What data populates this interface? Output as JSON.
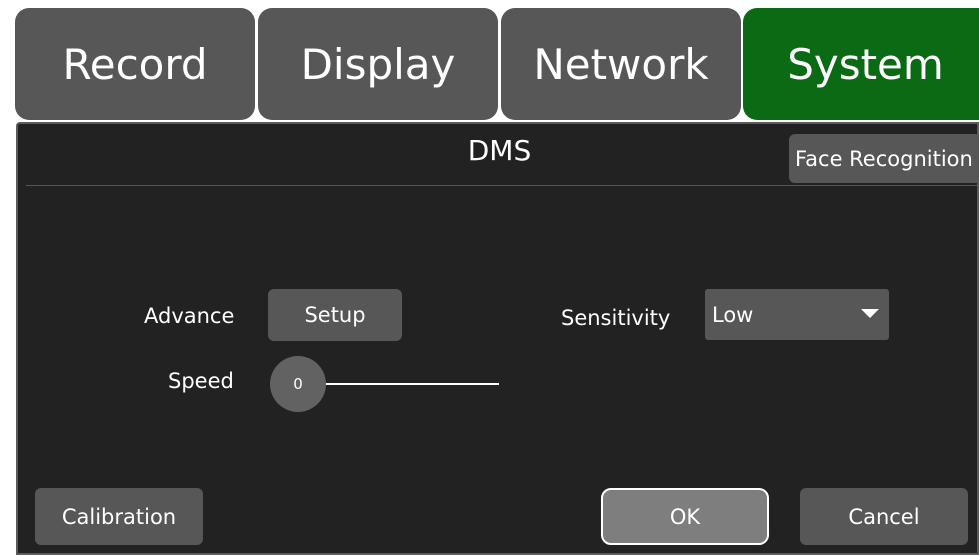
{
  "tabs": [
    {
      "label": "Record"
    },
    {
      "label": "Display"
    },
    {
      "label": "Network"
    },
    {
      "label": "System"
    }
  ],
  "panel": {
    "title": "DMS",
    "face_recognition_label": "Face Recognition",
    "advance_label": "Advance",
    "setup_label": "Setup",
    "sensitivity_label": "Sensitivity",
    "sensitivity_value": "Low",
    "speed_label": "Speed",
    "speed_value": "0"
  },
  "footer": {
    "calibration_label": "Calibration",
    "ok_label": "OK",
    "cancel_label": "Cancel"
  },
  "colors": {
    "tab": "#575757",
    "tab_active": "#0b6b14",
    "panel": "#222222"
  },
  "icons": {
    "dropdown": "caret-down-icon"
  }
}
